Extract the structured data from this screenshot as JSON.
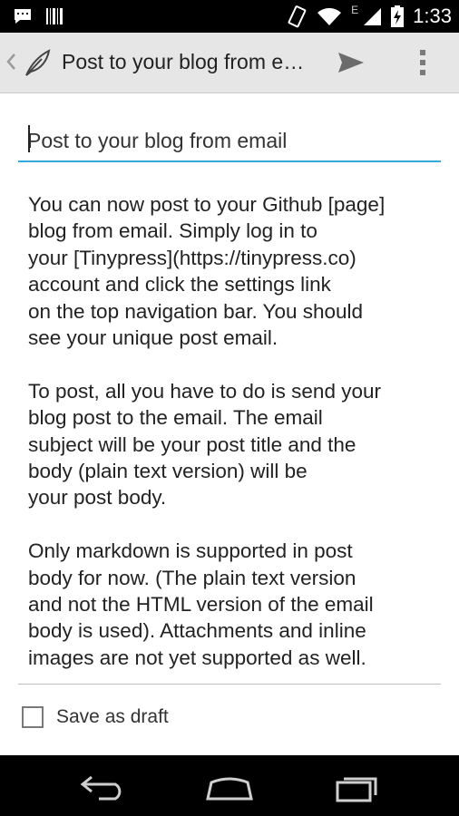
{
  "status_bar": {
    "time": "1:33",
    "network_label": "E",
    "icons": [
      "message-icon",
      "barcode-icon",
      "vibrate-icon",
      "wifi-icon",
      "signal-icon",
      "battery-charging-icon"
    ]
  },
  "action_bar": {
    "title": "Post to your blog from email",
    "icons": [
      "up-chevron-icon",
      "feather-logo-icon",
      "send-icon",
      "overflow-menu-icon"
    ]
  },
  "editor": {
    "title_value": "Post to your blog from email",
    "body_paragraphs": [
      "You can now post to your Github [page]\nblog from email. Simply log in to\nyour [Tinypress](https://tinypress.co)\naccount and click the settings link\non the top navigation bar. You should\nsee your unique post email.",
      "To post, all you have to do is send your\nblog post to the email. The email\nsubject will be your post title and the\nbody (plain text version) will be\nyour post body.",
      "Only markdown is supported in post\nbody for now. (The plain text version\nand not the HTML version of the email\nbody is used). Attachments and inline\nimages are not yet supported as well."
    ],
    "draft_label": "Save as draft",
    "draft_checked": false
  },
  "navigation_bar": {
    "icons": [
      "back-icon",
      "home-icon",
      "recent-apps-icon"
    ]
  },
  "colors": {
    "accent": "#33a9dc",
    "action_bar_bg": "#e6e6e6"
  }
}
